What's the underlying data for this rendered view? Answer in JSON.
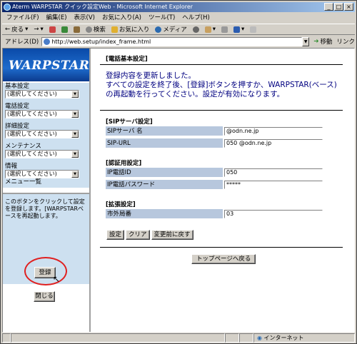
{
  "window": {
    "title": "Aterm WARPSTAR クイック設定Web - Microsoft Internet Explorer",
    "controls": [
      "_",
      "□",
      "×"
    ]
  },
  "menubar": [
    "ファイル(F)",
    "編集(E)",
    "表示(V)",
    "お気に入り(A)",
    "ツール(T)",
    "ヘルプ(H)"
  ],
  "toolbar": {
    "back": "戻る",
    "search": "検索",
    "favorites": "お気に入り",
    "media": "メディア"
  },
  "address": {
    "label": "アドレス(D)",
    "url": "http://web.setup/index_frame.html",
    "go": "移動",
    "links": "リンク"
  },
  "sidebar": {
    "logo": "WARPSTAR",
    "sections": [
      {
        "label": "基本設定",
        "value": "(選択してください)"
      },
      {
        "label": "電話設定",
        "value": "(選択してください)"
      },
      {
        "label": "詳細設定",
        "value": "(選択してください)"
      },
      {
        "label": "メンテナンス",
        "value": "(選択してください)"
      },
      {
        "label": "情報",
        "value": "(選択してください)"
      }
    ],
    "menu_list": "メニュー一覧",
    "note": "このボタンをクリックして設定を登録します。[WARPSTARベースを再起動します。",
    "register": "登録",
    "close": "閉じる"
  },
  "main": {
    "header": "[電話基本設定]",
    "message_lines": [
      "登録内容を更新しました。",
      "すべての設定を終了後、[登録]ボタンを押すか、WARPSTAR(ベース)",
      "の再起動を行ってください。設定が有効になります。"
    ],
    "sip": {
      "title": "[SIPサーバ設定]",
      "server_name_label": "SIPサーバ 名",
      "server_name_value": "@odn.ne.jp",
      "url_label": "SIP-URL",
      "url_value": "050          @odn.ne.jp"
    },
    "auth": {
      "title": "[認証用設定]",
      "phone_id_label": "IP電話ID",
      "phone_id_value": "050",
      "password_label": "IP電話パスワード",
      "password_value": "*****"
    },
    "ext": {
      "title": "[拡張設定]",
      "area_label": "市外局番",
      "area_value": "03"
    },
    "buttons": {
      "set": "設定",
      "clear": "クリア",
      "revert": "変更前に戻す"
    },
    "top_page": "トップページへ戻る"
  },
  "status": {
    "zone": "インターネット"
  }
}
